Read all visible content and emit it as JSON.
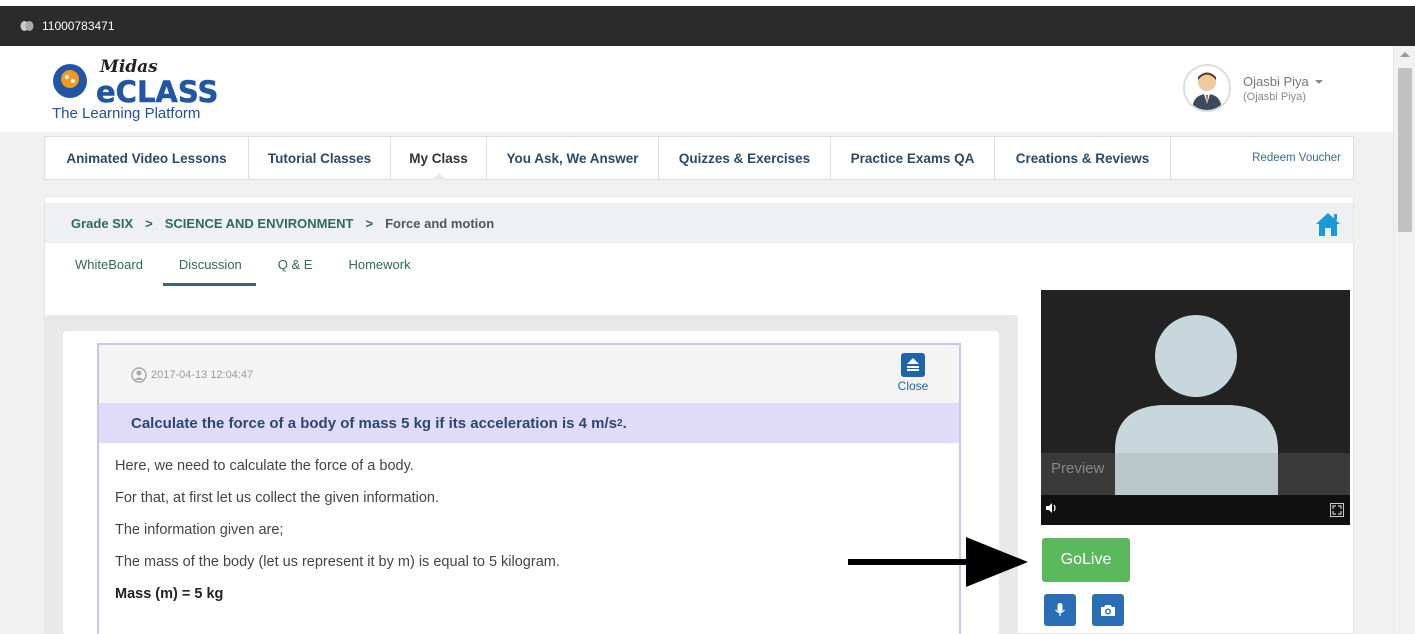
{
  "window": {
    "id_text": "11000783471"
  },
  "brand": {
    "logo_word_1": "Midas",
    "logo_word_2": "eCLASS",
    "tagline": "The Learning Platform"
  },
  "user": {
    "name": "Ojasbi Piya",
    "subname": "(Ojasbi Piya)"
  },
  "nav": {
    "items": [
      {
        "label": "Animated Video Lessons",
        "active": false
      },
      {
        "label": "Tutorial Classes",
        "active": false
      },
      {
        "label": "My Class",
        "active": true
      },
      {
        "label": "You Ask, We Answer",
        "active": false
      },
      {
        "label": "Quizzes & Exercises",
        "active": false
      },
      {
        "label": "Practice Exams QA",
        "active": false
      },
      {
        "label": "Creations & Reviews",
        "active": false
      }
    ],
    "redeem": "Redeem Voucher"
  },
  "breadcrumb": {
    "grade": "Grade SIX",
    "subject": "SCIENCE AND ENVIRONMENT",
    "topic": "Force and motion"
  },
  "subtabs": [
    {
      "label": "WhiteBoard",
      "active": false
    },
    {
      "label": "Discussion",
      "active": true
    },
    {
      "label": "Q & E",
      "active": false
    },
    {
      "label": "Homework",
      "active": false
    }
  ],
  "post": {
    "timestamp": "2017-04-13 12:04:47",
    "close_label": "Close",
    "question_text": "Calculate the force of a body of mass 5 kg if its acceleration is 4 m/s",
    "question_sup": "2",
    "question_end": ".",
    "answer_lines": [
      "Here, we need to calculate the force of a body.",
      "For that, at first let us collect the given information.",
      "The information given are;",
      "The mass of the body (let us represent it by m) is equal to 5 kilogram."
    ],
    "answer_bold": "Mass (m) = 5 kg"
  },
  "video": {
    "preview_label": "Preview"
  },
  "actions": {
    "golive_label": "GoLive"
  },
  "colors": {
    "accent_blue": "#1f63a8",
    "golive_green": "#5cb85c",
    "question_bg": "#e1dbfa",
    "crumb_green": "#2f6b55"
  }
}
